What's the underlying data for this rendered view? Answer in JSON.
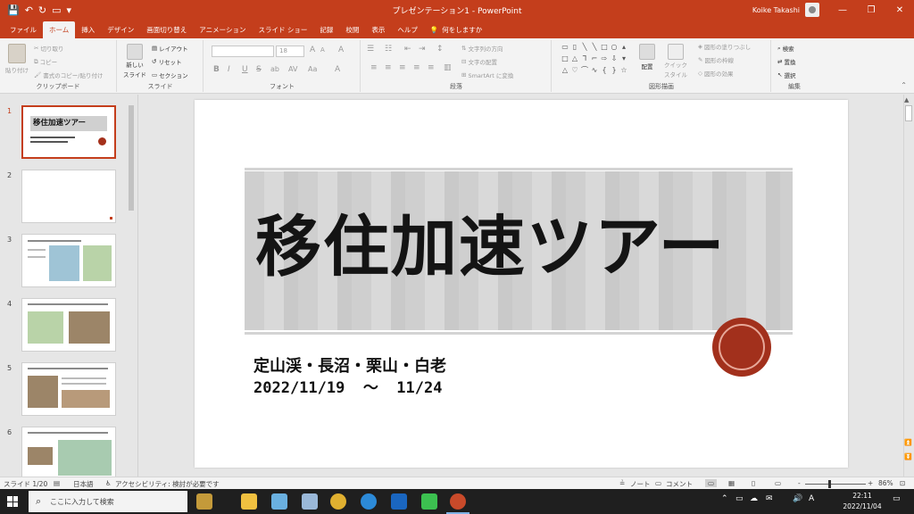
{
  "window": {
    "title": "プレゼンテーション1  -  PowerPoint",
    "user": "Koike Takashi",
    "buttons": [
      "—",
      "❐",
      "✕"
    ]
  },
  "qat": [
    "💾",
    "↶",
    "↻",
    "▭",
    "▾"
  ],
  "tabs": [
    "ファイル",
    "ホーム",
    "挿入",
    "デザイン",
    "画面切り替え",
    "アニメーション",
    "スライド ショー",
    "記録",
    "校閲",
    "表示",
    "ヘルプ"
  ],
  "tell_me": "何をしますか",
  "ribbon": {
    "clipboard": {
      "label": "クリップボード",
      "paste": "貼り付け",
      "cut": "切り取り",
      "copy": "コピー",
      "format": "書式のコピー/貼り付け"
    },
    "slides": {
      "label": "スライド",
      "new": "新しい",
      "new2": "スライド",
      "layout": "レイアウト",
      "reset": "リセット",
      "section": "セクション"
    },
    "font": {
      "label": "フォント",
      "bold": "B",
      "italic": "I",
      "underline": "U",
      "strike": "S",
      "shadow": "ab",
      "spacing": "AV",
      "case": "Aa",
      "size_up": "A",
      "size_down": "A",
      "clear": "A",
      "color": "A",
      "size": "18"
    },
    "paragraph": {
      "label": "段落",
      "dir": "文字列の方向",
      "align": "文字の配置",
      "smartart": "SmartArt に変換"
    },
    "drawing": {
      "label": "図形描画",
      "arrange": "配置",
      "quick1": "クイック",
      "quick2": "スタイル",
      "fill": "図形の塗りつぶし",
      "outline": "図形の枠線",
      "effect": "図形の効果"
    },
    "editing": {
      "label": "編集",
      "find": "検索",
      "replace": "置換",
      "select": "選択"
    }
  },
  "slides_pane": {
    "numbers": [
      "1",
      "2",
      "3",
      "4",
      "5",
      "6"
    ],
    "thumb1_title": "移住加速ツアー"
  },
  "slide": {
    "title": "移住加速ツアー",
    "subtitle_line1": "定山渓・長沼・栗山・白老",
    "subtitle_line2": "2022/11/19  ～  11/24"
  },
  "status": {
    "slide": "スライド 1/20",
    "lang": "日本語",
    "accessibility": "アクセシビリティ: 検討が必要です",
    "notes": "ノート",
    "comments": "コメント",
    "zoom": "86%",
    "zoom_minus": "-",
    "zoom_plus": "+"
  },
  "taskbar": {
    "search_placeholder": "ここに入力して検索",
    "time": "22:11",
    "date": "2022/11/04",
    "tray": [
      "⌃",
      "▭",
      "☁",
      "✉",
      "🔊",
      "A"
    ]
  }
}
